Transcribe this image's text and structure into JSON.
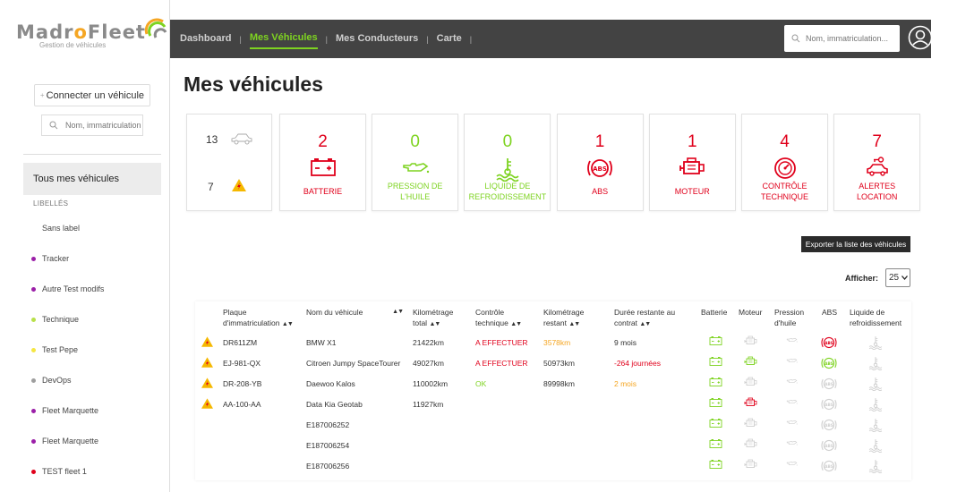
{
  "brand": {
    "name_pre": "Madr",
    "name_o": "o",
    "name_post": "Fleet",
    "tagline": "Gestion de véhicules"
  },
  "sidebar": {
    "connect_label": "Connecter un véhicule",
    "search_placeholder": "Nom, immatriculation",
    "all_vehicles": "Tous mes véhicules",
    "labels_title": "LIBELLÉS",
    "items": [
      {
        "label": "Sans label",
        "color": ""
      },
      {
        "label": "Tracker",
        "color": "#9b1fa8"
      },
      {
        "label": "Autre Test modifs",
        "color": "#9b1fa8"
      },
      {
        "label": "Technique",
        "color": "#b8e04a"
      },
      {
        "label": "Test Pepe",
        "color": "#f5e642"
      },
      {
        "label": "DevOps",
        "color": "#9e9e9e"
      },
      {
        "label": "Fleet Marquette",
        "color": "#9b1fa8"
      },
      {
        "label": "Fleet Marquette",
        "color": "#9b1fa8"
      },
      {
        "label": "TEST fleet 1",
        "color": "#e0001b"
      }
    ]
  },
  "nav": {
    "links": [
      "Dashboard",
      "Mes Véhicules",
      "Mes Conducteurs",
      "Carte"
    ],
    "active_index": 1,
    "search_placeholder": "Nom, immatriculation..."
  },
  "page_title": "Mes véhicules",
  "summary": {
    "total": "13",
    "alerts": "7"
  },
  "cards": [
    {
      "value": "2",
      "label": "BATTERIE",
      "status": "red",
      "icon": "battery-icon"
    },
    {
      "value": "0",
      "label": "PRESSION DE L'HUILE",
      "status": "green",
      "icon": "oil-can-icon"
    },
    {
      "value": "0",
      "label": "LIQUIDE DE REFROIDISSEMENT",
      "status": "green",
      "icon": "coolant-icon"
    },
    {
      "value": "1",
      "label": "ABS",
      "status": "red",
      "icon": "abs-icon"
    },
    {
      "value": "1",
      "label": "MOTEUR",
      "status": "red",
      "icon": "engine-icon"
    },
    {
      "value": "4",
      "label": "CONTRÔLE TECHNIQUE",
      "status": "red",
      "icon": "gauge-icon"
    },
    {
      "value": "7",
      "label": "ALERTES LOCATION",
      "status": "red",
      "icon": "car-key-icon"
    }
  ],
  "export_label": "Exporter la liste des véhicules",
  "afficher_label": "Afficher:",
  "per_page": "25",
  "table": {
    "headers": {
      "plate": "Plaque d'immatriculation",
      "name": "Nom du véhicule",
      "km_total": "Kilométrage total",
      "ct": "Contrôle technique",
      "km_rest": "Kilométrage restant",
      "duration": "Durée restante au contrat",
      "battery": "Batterie",
      "engine": "Moteur",
      "oil": "Pression d'huile",
      "abs": "ABS",
      "coolant": "Liquide de refroidissement"
    },
    "rows": [
      {
        "warn": true,
        "plate": "DR611ZM",
        "name": "BMW X1",
        "km_total": "21422km",
        "ct": "A EFFECTUER",
        "ct_status": "red",
        "km_rest": "3578km",
        "km_rest_status": "orange",
        "duration": "9 mois",
        "duration_status": "",
        "battery": "green",
        "engine": "grey",
        "oil": "grey",
        "abs": "red",
        "coolant": "grey"
      },
      {
        "warn": true,
        "plate": "EJ-981-QX",
        "name": "Citroen Jumpy SpaceTourer",
        "km_total": "49027km",
        "ct": "A EFFECTUER",
        "ct_status": "red",
        "km_rest": "50973km",
        "km_rest_status": "",
        "duration": "-264 journées",
        "duration_status": "red",
        "battery": "green",
        "engine": "green",
        "oil": "grey",
        "abs": "green",
        "coolant": "grey"
      },
      {
        "warn": true,
        "plate": "DR-208-YB",
        "name": "Daewoo Kalos",
        "km_total": "110002km",
        "ct": "OK",
        "ct_status": "green",
        "km_rest": "89998km",
        "km_rest_status": "",
        "duration": "2 mois",
        "duration_status": "orange",
        "battery": "green",
        "engine": "grey",
        "oil": "grey",
        "abs": "grey",
        "coolant": "grey"
      },
      {
        "warn": true,
        "plate": "AA-100-AA",
        "name": "Data Kia Geotab",
        "km_total": "11927km",
        "ct": "",
        "ct_status": "",
        "km_rest": "",
        "km_rest_status": "",
        "duration": "",
        "duration_status": "",
        "battery": "green",
        "engine": "red",
        "oil": "grey",
        "abs": "grey",
        "coolant": "grey"
      },
      {
        "warn": false,
        "plate": "",
        "name": "E187006252",
        "km_total": "",
        "ct": "",
        "ct_status": "",
        "km_rest": "",
        "km_rest_status": "",
        "duration": "",
        "duration_status": "",
        "battery": "green",
        "engine": "grey",
        "oil": "grey",
        "abs": "grey",
        "coolant": "grey"
      },
      {
        "warn": false,
        "plate": "",
        "name": "E187006254",
        "km_total": "",
        "ct": "",
        "ct_status": "",
        "km_rest": "",
        "km_rest_status": "",
        "duration": "",
        "duration_status": "",
        "battery": "green",
        "engine": "grey",
        "oil": "grey",
        "abs": "grey",
        "coolant": "grey"
      },
      {
        "warn": false,
        "plate": "",
        "name": "E187006256",
        "km_total": "",
        "ct": "",
        "ct_status": "",
        "km_rest": "",
        "km_rest_status": "",
        "duration": "",
        "duration_status": "",
        "battery": "green",
        "engine": "grey",
        "oil": "grey",
        "abs": "grey",
        "coolant": "grey"
      }
    ]
  },
  "colors": {
    "red": "#e0001b",
    "green": "#7ed321",
    "orange": "#f5a623",
    "grey": "#c4c4c4",
    "nav_bg": "#434343"
  }
}
